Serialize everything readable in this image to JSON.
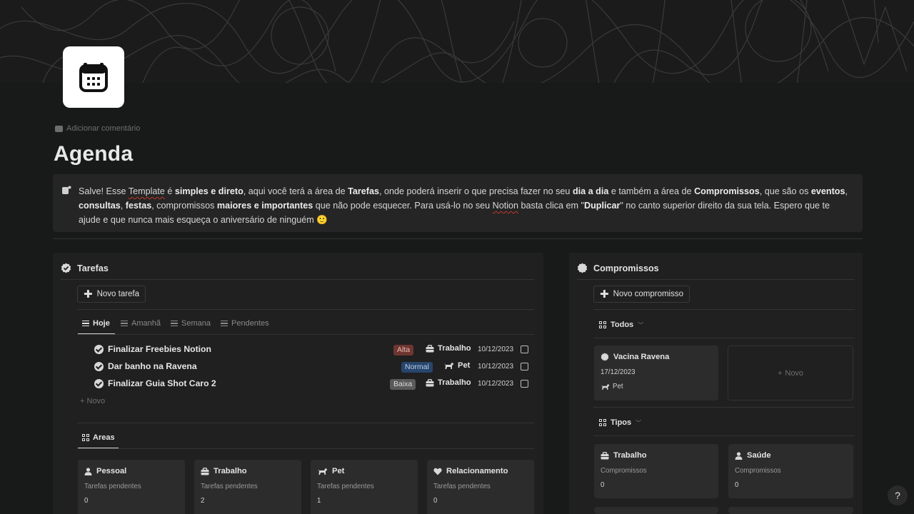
{
  "page": {
    "add_comment": "Adicionar comentário",
    "title": "Agenda",
    "callout": {
      "t1": "Salve! Esse ",
      "template": "Template",
      "t2": " é ",
      "b1": "simples e direto",
      "t3": ", aqui você terá a área de ",
      "b2": "Tarefas",
      "t4": ", onde poderá inserir o que precisa fazer no seu ",
      "b3": "dia a dia",
      "t5": " e também a área de ",
      "b4": "Compromissos",
      "t6": ", que são os ",
      "b5": "eventos",
      "t7": ", ",
      "b6": "consultas",
      "t8": ", ",
      "b7": "festas",
      "t9": ", compromissos ",
      "b8": "maiores e importantes",
      "t10": " que não pode esquecer. Para usá-lo no seu ",
      "notion": "Notion",
      "t11": " basta clica em \"",
      "b9": "Duplicar",
      "t12": "\" no canto superior direito da sua tela. Espero que te ajude e que nunca mais esqueça o aniversário de ninguém 🙂"
    }
  },
  "tarefas": {
    "heading": "Tarefas",
    "new_button": "Novo tarefa",
    "tabs": [
      {
        "label": "Hoje"
      },
      {
        "label": "Amanhã"
      },
      {
        "label": "Semana"
      },
      {
        "label": "Pendentes"
      }
    ],
    "rows": [
      {
        "title": "Finalizar Freebies Notion",
        "priority": "Alta",
        "area": "Trabalho",
        "date": "10/12/2023"
      },
      {
        "title": "Dar banho na Ravena",
        "priority": "Normal",
        "area": "Pet",
        "date": "10/12/2023"
      },
      {
        "title": "Finalizar Guia Shot Caro 2",
        "priority": "Baixa",
        "area": "Trabalho",
        "date": "10/12/2023"
      }
    ],
    "new_row": "Novo",
    "areas_tab": "Areas",
    "area_cards": [
      {
        "title": "Pessoal",
        "label": "Tarefas pendentes",
        "value": "0"
      },
      {
        "title": "Trabalho",
        "label": "Tarefas pendentes",
        "value": "2"
      },
      {
        "title": "Pet",
        "label": "Tarefas pendentes",
        "value": "1"
      },
      {
        "title": "Relacionamento",
        "label": "Tarefas pendentes",
        "value": "0"
      }
    ]
  },
  "compromissos": {
    "heading": "Compromissos",
    "new_button": "Novo compromisso",
    "view_todos": "Todos",
    "event_card": {
      "title": "Vacina Ravena",
      "date": "17/12/2023",
      "tag": "Pet"
    },
    "new_card": "Novo",
    "view_tipos": "Tipos",
    "tipo_cards": [
      {
        "title": "Trabalho",
        "label": "Compromissos",
        "value": "0"
      },
      {
        "title": "Saúde",
        "label": "Compromissos",
        "value": "0"
      }
    ]
  },
  "help": "?",
  "colors": {
    "alta": "#6e3630",
    "normal": "#28456c",
    "baixa": "#5a5a5a"
  }
}
